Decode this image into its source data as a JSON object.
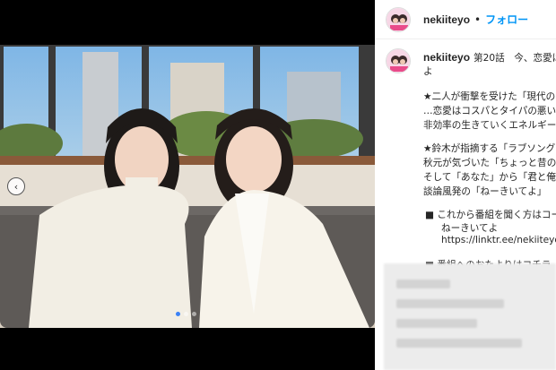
{
  "post": {
    "username": "nekiiteyo",
    "separator": "•",
    "follow_label": "フォロー"
  },
  "caption": {
    "username": "nekiiteyo",
    "lines": [
      "第20話　今、恋愛は",
      "よ",
      "★二人が衝撃を受けた「現代の",
      "…恋愛はコスパとタイパの悪い",
      "非効率の生きていくエネルギー",
      "★鈴木が指摘する「ラブソング",
      "秋元が気づいた「ちょっと昔の",
      "そして「あなた」から「君と俺",
      "談論風発の「ねーきいてよ」",
      "■ これから番組を聞く方はコー",
      "ねーきいてよ",
      "https://linktr.ee/nekiiteyo",
      "■ 番組へのおたよりはコチラ"
    ]
  },
  "carousel": {
    "prev_glyph": "‹",
    "slide_count": 3,
    "active_index": 1
  },
  "colors": {
    "link": "#0095f6",
    "active_dot": "#3b82f6"
  },
  "icons": {
    "prev": "chevron-left-icon"
  }
}
